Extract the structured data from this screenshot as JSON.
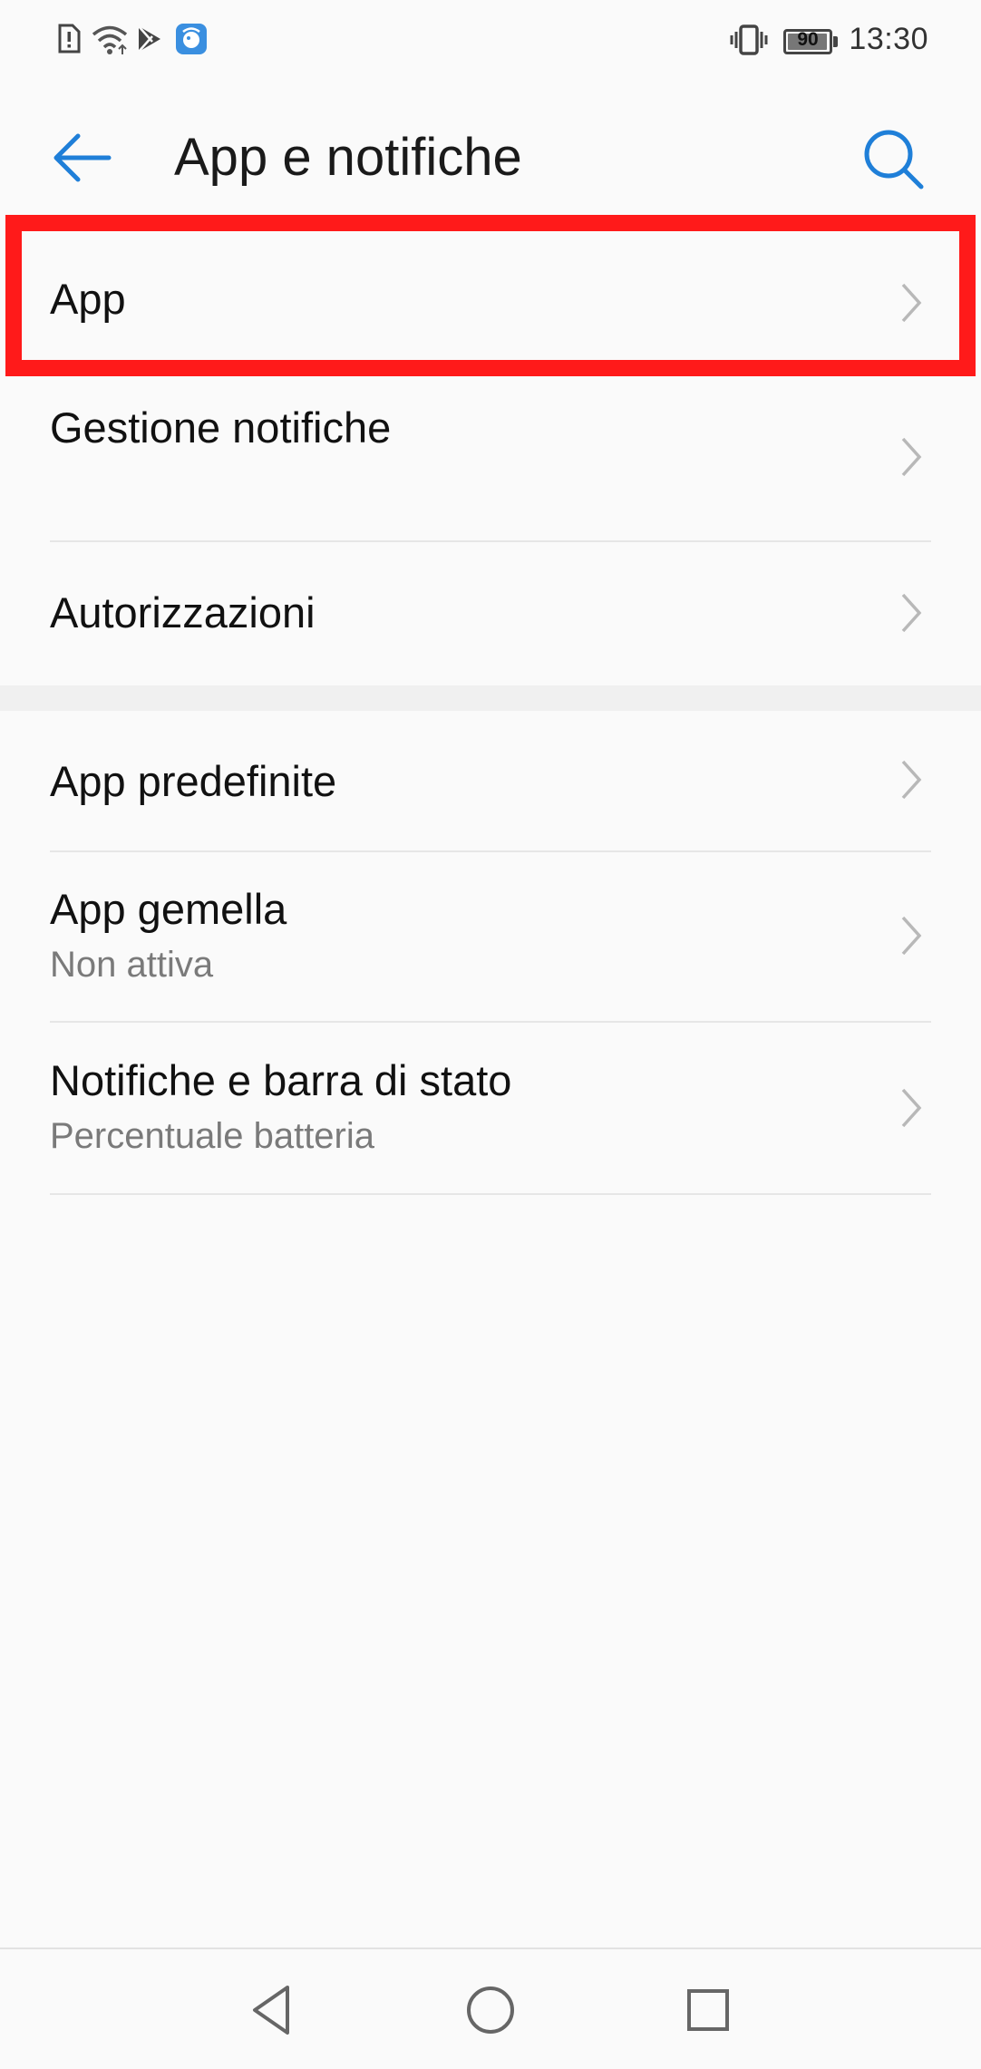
{
  "status_bar": {
    "time": "13:30",
    "battery_level": "90",
    "icons": [
      "sim-alert-icon",
      "wifi-icon",
      "play-store-icon",
      "app-notification-icon",
      "vibrate-icon",
      "battery-icon"
    ]
  },
  "header": {
    "title": "App e notifiche",
    "back_icon": "arrow-left-icon",
    "search_icon": "search-icon"
  },
  "colors": {
    "accent": "#1f7fd8",
    "highlight": "#ff1a1a",
    "subtitle": "#7a7a7a"
  },
  "settings": {
    "group1": [
      {
        "title": "App",
        "highlighted": true
      },
      {
        "title": "Gestione notifiche"
      },
      {
        "title": "Autorizzazioni"
      }
    ],
    "group2": [
      {
        "title": "App predefinite"
      },
      {
        "title": "App gemella",
        "subtitle": "Non attiva"
      },
      {
        "title": "Notifiche e barra di stato",
        "subtitle": "Percentuale batteria"
      }
    ]
  },
  "nav": {
    "icons": [
      "back-triangle-icon",
      "home-circle-icon",
      "recents-square-icon"
    ]
  }
}
